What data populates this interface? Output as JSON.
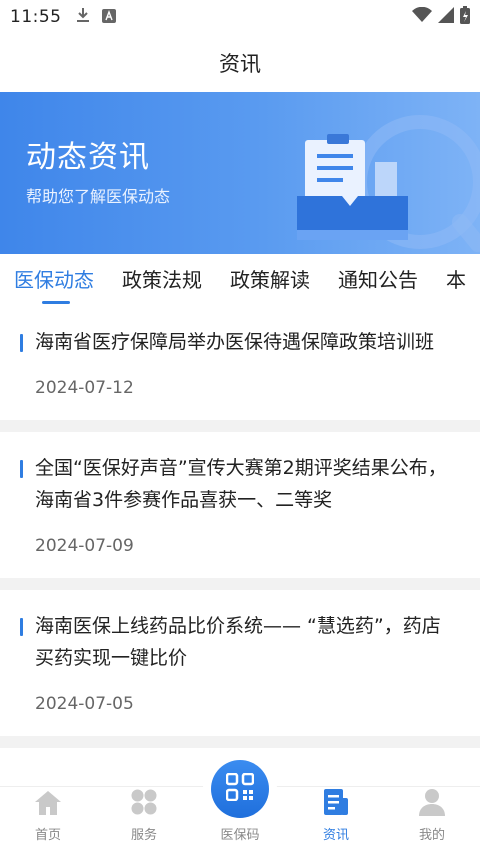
{
  "status_bar": {
    "time": "11:55",
    "icons": [
      "download-icon",
      "a-badge-icon",
      "wifi-icon",
      "signal-icon",
      "battery-icon"
    ]
  },
  "header": {
    "title": "资讯"
  },
  "banner": {
    "title": "动态资讯",
    "subtitle": "帮助您了解医保动态"
  },
  "tabs": [
    {
      "label": "医保动态",
      "active": true
    },
    {
      "label": "政策法规",
      "active": false
    },
    {
      "label": "政策解读",
      "active": false
    },
    {
      "label": "通知公告",
      "active": false
    },
    {
      "label": "本",
      "active": false
    }
  ],
  "news": [
    {
      "title": "海南省医疗保障局举办医保待遇保障政策培训班",
      "date": "2024-07-12"
    },
    {
      "title": "全国“医保好声音”宣传大赛第2期评奖结果公布，海南省3件参赛作品喜获一、二等奖",
      "date": "2024-07-09"
    },
    {
      "title": "海南医保上线药品比价系统—— “慧选药”，药店买药实现一键比价",
      "date": "2024-07-05"
    }
  ],
  "tabbar": {
    "items": [
      {
        "label": "首页",
        "icon": "home-icon"
      },
      {
        "label": "服务",
        "icon": "grid-icon"
      },
      {
        "label": "医保码",
        "icon": "qr-code-icon"
      },
      {
        "label": "资讯",
        "icon": "news-icon",
        "active": true
      },
      {
        "label": "我的",
        "icon": "person-icon"
      }
    ]
  },
  "colors": {
    "accent": "#2f7de1",
    "banner_start": "#3f86ea",
    "banner_end": "#7eb3f6"
  }
}
